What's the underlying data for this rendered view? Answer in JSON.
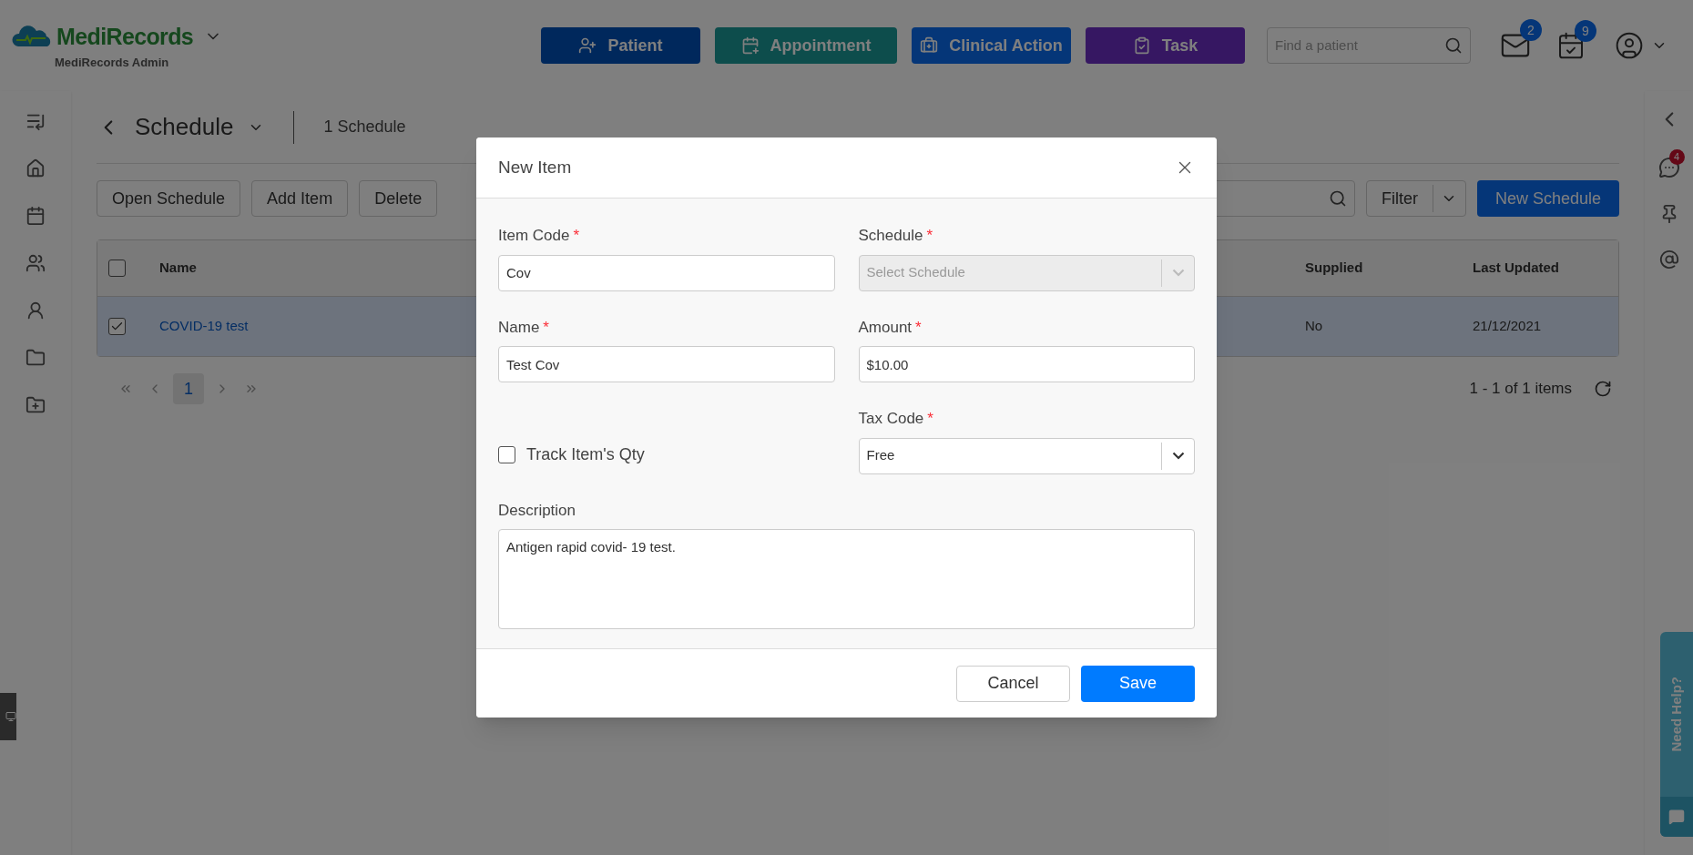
{
  "header": {
    "logo": "MediRecords",
    "subtitle": "MediRecords Admin",
    "nav_buttons": [
      {
        "label": "Patient",
        "kind": "patient"
      },
      {
        "label": "Appointment",
        "kind": "appointment"
      },
      {
        "label": "Clinical Action",
        "kind": "clinical"
      },
      {
        "label": "Task",
        "kind": "task"
      }
    ],
    "search": {
      "placeholder": "Find a patient"
    },
    "mail_badge": "2",
    "tasks_badge": "9"
  },
  "page": {
    "title": "Schedule",
    "count": "1 Schedule",
    "toolbar": [
      "Open Schedule",
      "Add Item",
      "Delete"
    ],
    "filter": "Filter",
    "new_button": "New Schedule"
  },
  "table": {
    "header_checked": false,
    "columns": [
      "Name",
      "Supplied",
      "Last Updated"
    ],
    "rows": [
      {
        "selected": true,
        "checked": true,
        "cells": [
          "COVID-19 test",
          "No",
          "21/12/2021"
        ]
      }
    ]
  },
  "pagination": {
    "pages": [
      {
        "label": "1",
        "selected": true
      }
    ],
    "summary": "1 - 1 of 1 items"
  },
  "right_rail": {
    "chat_badge": "4"
  },
  "help": "Need Help?",
  "modal": {
    "title": "New Item",
    "fields": [
      {
        "kind": "text",
        "label": "Item Code",
        "required_mark": "*",
        "value": "Cov"
      },
      {
        "kind": "select",
        "label": "Schedule",
        "required_mark": "*",
        "placeholder": "Select Schedule",
        "disabled": true
      },
      {
        "kind": "text",
        "label": "Name",
        "required_mark": "*",
        "value": "Test Cov"
      },
      {
        "kind": "text",
        "label": "Amount",
        "required_mark": "*",
        "value": "$10.00"
      },
      {
        "kind": "checkbox",
        "label": "Track Item's Qty",
        "checked": false
      },
      {
        "kind": "select",
        "label": "Tax Code",
        "required_mark": "*",
        "value": "Free",
        "disabled": false
      },
      {
        "kind": "textarea",
        "label": "Description",
        "value": "Antigen rapid covid- 19 test."
      }
    ],
    "buttons": [
      {
        "label": "Cancel",
        "kind": "secondary"
      },
      {
        "label": "Save",
        "kind": "primary"
      }
    ]
  }
}
